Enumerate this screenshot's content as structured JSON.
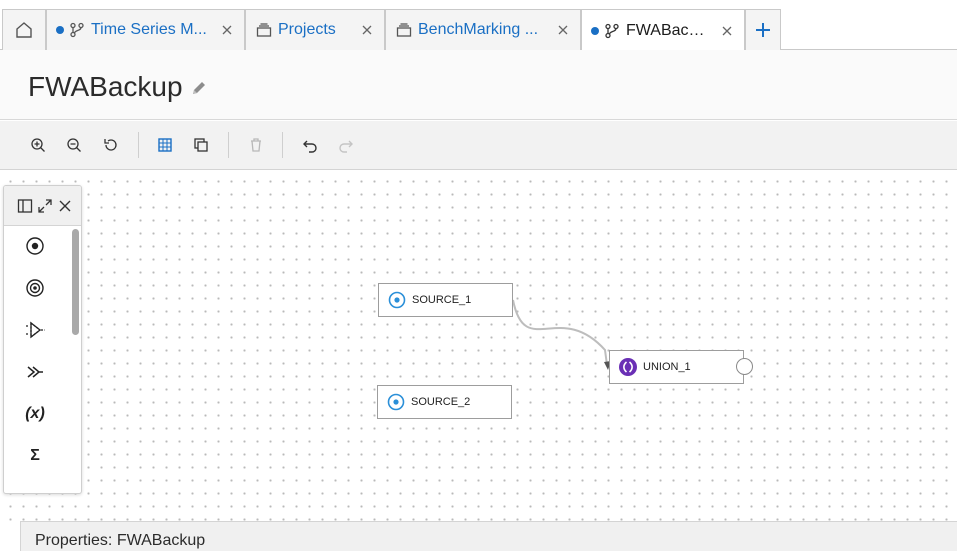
{
  "tabs": [
    {
      "label": "Time Series M...",
      "modified": true,
      "icon": "dataflow-icon"
    },
    {
      "label": "Projects",
      "modified": false,
      "icon": "project-icon"
    },
    {
      "label": "BenchMarking ...",
      "modified": false,
      "icon": "project-icon"
    },
    {
      "label": "FWABackup",
      "modified": true,
      "icon": "dataflow-icon",
      "active": true
    }
  ],
  "page": {
    "title": "FWABackup"
  },
  "toolbar": {
    "buttons": [
      "zoom-in-icon",
      "zoom-out-icon",
      "reset-zoom-icon",
      "grid-icon",
      "copy-icon",
      "delete-icon",
      "undo-icon",
      "redo-icon"
    ]
  },
  "palette": {
    "items": [
      "source-icon",
      "target-icon",
      "filter-icon",
      "join-icon",
      "expression-icon",
      "aggregate-icon"
    ],
    "expression_glyph": "(x)",
    "aggregate_glyph": "Σ"
  },
  "nodes": {
    "source_1": "SOURCE_1",
    "source_2": "SOURCE_2",
    "union_1": "UNION_1"
  },
  "properties": {
    "title": "Properties: FWABackup"
  },
  "colors": {
    "accent": "#1a6fc4",
    "source": "#2a8fd8",
    "union": "#6a2fb5"
  }
}
